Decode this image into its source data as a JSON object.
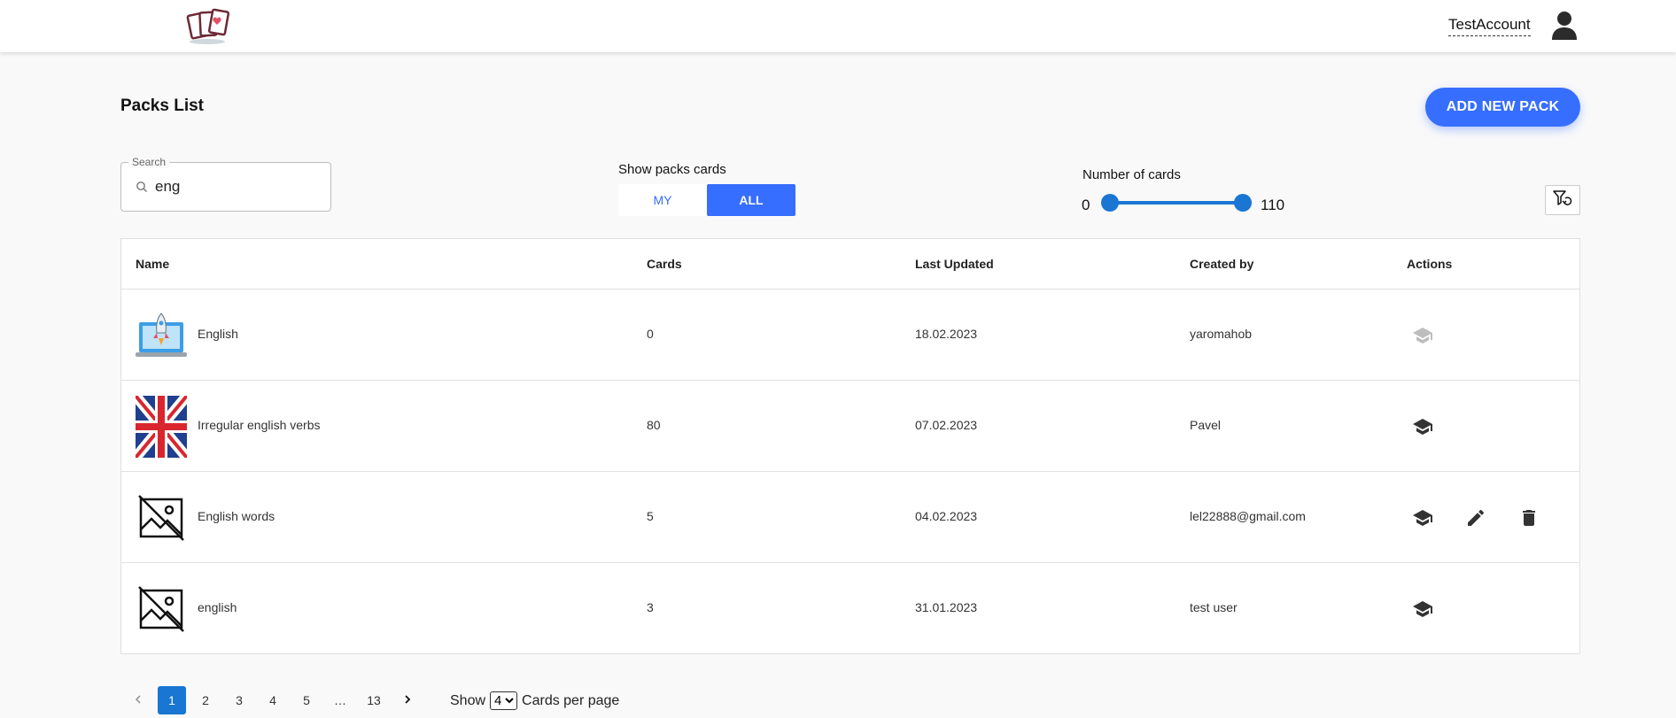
{
  "header": {
    "account_name": "TestAccount",
    "logo_icon": "cards-logo-icon",
    "avatar_icon": "user-icon"
  },
  "page": {
    "title": "Packs List",
    "add_button": "ADD NEW PACK"
  },
  "search": {
    "label": "Search",
    "value": "eng"
  },
  "show_packs": {
    "label": "Show packs cards",
    "my": "MY",
    "all": "ALL",
    "selected": "ALL"
  },
  "num_cards": {
    "label": "Number of cards",
    "min": "0",
    "max": "110"
  },
  "table": {
    "headers": [
      "Name",
      "Cards",
      "Last Updated",
      "Created by",
      "Actions"
    ],
    "rows": [
      {
        "name": "English",
        "cards": "0",
        "updated": "18.02.2023",
        "created_by": "yaromahob",
        "thumb": "laptop-rocket-image",
        "actions": [
          "learn-icon-disabled"
        ]
      },
      {
        "name": "Irregular english verbs",
        "cards": "80",
        "updated": "07.02.2023",
        "created_by": "Pavel",
        "thumb": "uk-flag-image",
        "actions": [
          "learn-icon"
        ]
      },
      {
        "name": "English words",
        "cards": "5",
        "updated": "04.02.2023",
        "created_by": "lel22888@gmail.com",
        "thumb": "no-image-icon",
        "actions": [
          "learn-icon",
          "edit-icon",
          "delete-icon"
        ]
      },
      {
        "name": "english",
        "cards": "3",
        "updated": "31.01.2023",
        "created_by": "test user",
        "thumb": "no-image-icon",
        "actions": [
          "learn-icon"
        ]
      }
    ]
  },
  "pagination": {
    "pages": [
      "1",
      "2",
      "3",
      "4",
      "5",
      "…",
      "13"
    ],
    "current": "1",
    "show_label": "Show",
    "per_page_value": "4",
    "per_page_suffix": "Cards per page"
  },
  "colors": {
    "primary": "#366eff",
    "slider": "#1976d2"
  }
}
